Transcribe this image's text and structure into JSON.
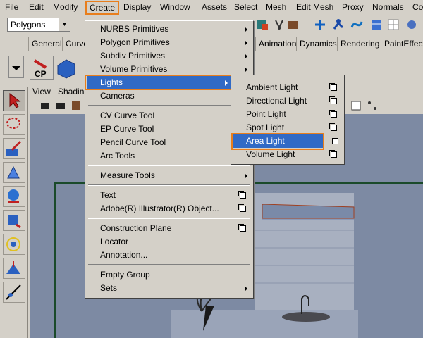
{
  "menubar": {
    "items": [
      "File",
      "Edit",
      "Modify",
      "Create",
      "Display",
      "Window",
      "Assets",
      "Select",
      "Mesh",
      "Edit Mesh",
      "Proxy",
      "Normals",
      "Co"
    ]
  },
  "toolbar": {
    "mode_value": "Polygons"
  },
  "shelf": {
    "tabs": [
      "General",
      "Curve",
      "Animation",
      "Dynamics",
      "Rendering",
      "PaintEffects"
    ],
    "cp_label": "CP"
  },
  "panel": {
    "menu": [
      "View",
      "Shadin"
    ]
  },
  "create_menu": {
    "items": [
      {
        "label": "NURBS Primitives",
        "submenu": true
      },
      {
        "label": "Polygon Primitives",
        "submenu": true
      },
      {
        "label": "Subdiv Primitives",
        "submenu": true
      },
      {
        "label": "Volume Primitives",
        "submenu": true
      },
      {
        "label": "Lights",
        "submenu": true,
        "highlighted": true
      },
      {
        "label": "Cameras",
        "submenu": true
      },
      {
        "label": "CV Curve Tool"
      },
      {
        "label": "EP Curve Tool"
      },
      {
        "label": "Pencil Curve Tool"
      },
      {
        "label": "Arc Tools",
        "submenu": true
      },
      {
        "label": "Measure Tools",
        "submenu": true
      },
      {
        "label": "Text",
        "option_box": true
      },
      {
        "label": "Adobe(R) Illustrator(R) Object...",
        "option_box": true
      },
      {
        "label": "Construction Plane",
        "option_box": true
      },
      {
        "label": "Locator"
      },
      {
        "label": "Annotation..."
      },
      {
        "label": "Empty Group"
      },
      {
        "label": "Sets",
        "submenu": true
      }
    ]
  },
  "lights_menu": {
    "items": [
      {
        "label": "Ambient Light"
      },
      {
        "label": "Directional Light"
      },
      {
        "label": "Point Light"
      },
      {
        "label": "Spot Light"
      },
      {
        "label": "Area Light",
        "highlighted": true
      },
      {
        "label": "Volume Light"
      }
    ]
  },
  "colors": {
    "highlight": "#316ac5",
    "focus_frame": "#e87e1c",
    "menu_bg": "#d4d0c8"
  }
}
